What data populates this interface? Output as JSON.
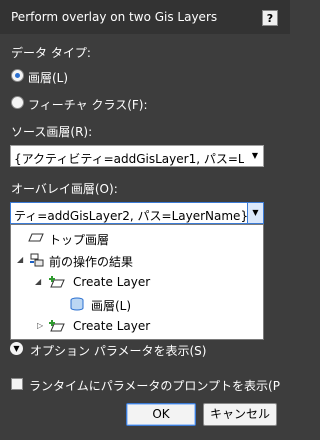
{
  "window": {
    "title": "Perform overlay on two Gis Layers",
    "help_label": "?"
  },
  "data_type": {
    "label": "データ タイプ:",
    "options": [
      {
        "label": "画層(L)",
        "checked": true
      },
      {
        "label": "フィーチャ クラス(F):",
        "checked": false
      }
    ]
  },
  "source": {
    "label": "ソース画層(R):",
    "value": "{アクティビティ=addGisLayer1, パス=L"
  },
  "overlay": {
    "label": "オーバレイ画層(O):",
    "value": "ティ=addGisLayer2, パス=LayerName}"
  },
  "tree": {
    "items": [
      {
        "label": "トップ画層",
        "icon": "layer-icon"
      },
      {
        "label": "前の操作の結果",
        "icon": "operation-icon",
        "expander": "expanded"
      },
      {
        "label": "Create Layer",
        "icon": "create-layer-icon",
        "expander": "expanded"
      },
      {
        "label": "画層(L)",
        "icon": "database-icon"
      },
      {
        "label": "Create Layer",
        "icon": "create-layer-icon",
        "expander": "collapsed"
      }
    ]
  },
  "options": {
    "show_params_label": "オプション パラメータを表示(S)",
    "prompt_label": "ランタイムにパラメータのプロンプトを表示(P",
    "prompt_checked": false
  },
  "buttons": {
    "ok": "OK",
    "cancel": "キャンセル"
  },
  "colors": {
    "background": "#3d3d3d",
    "titlebar": "#333333",
    "accent": "#3b7bd6"
  }
}
